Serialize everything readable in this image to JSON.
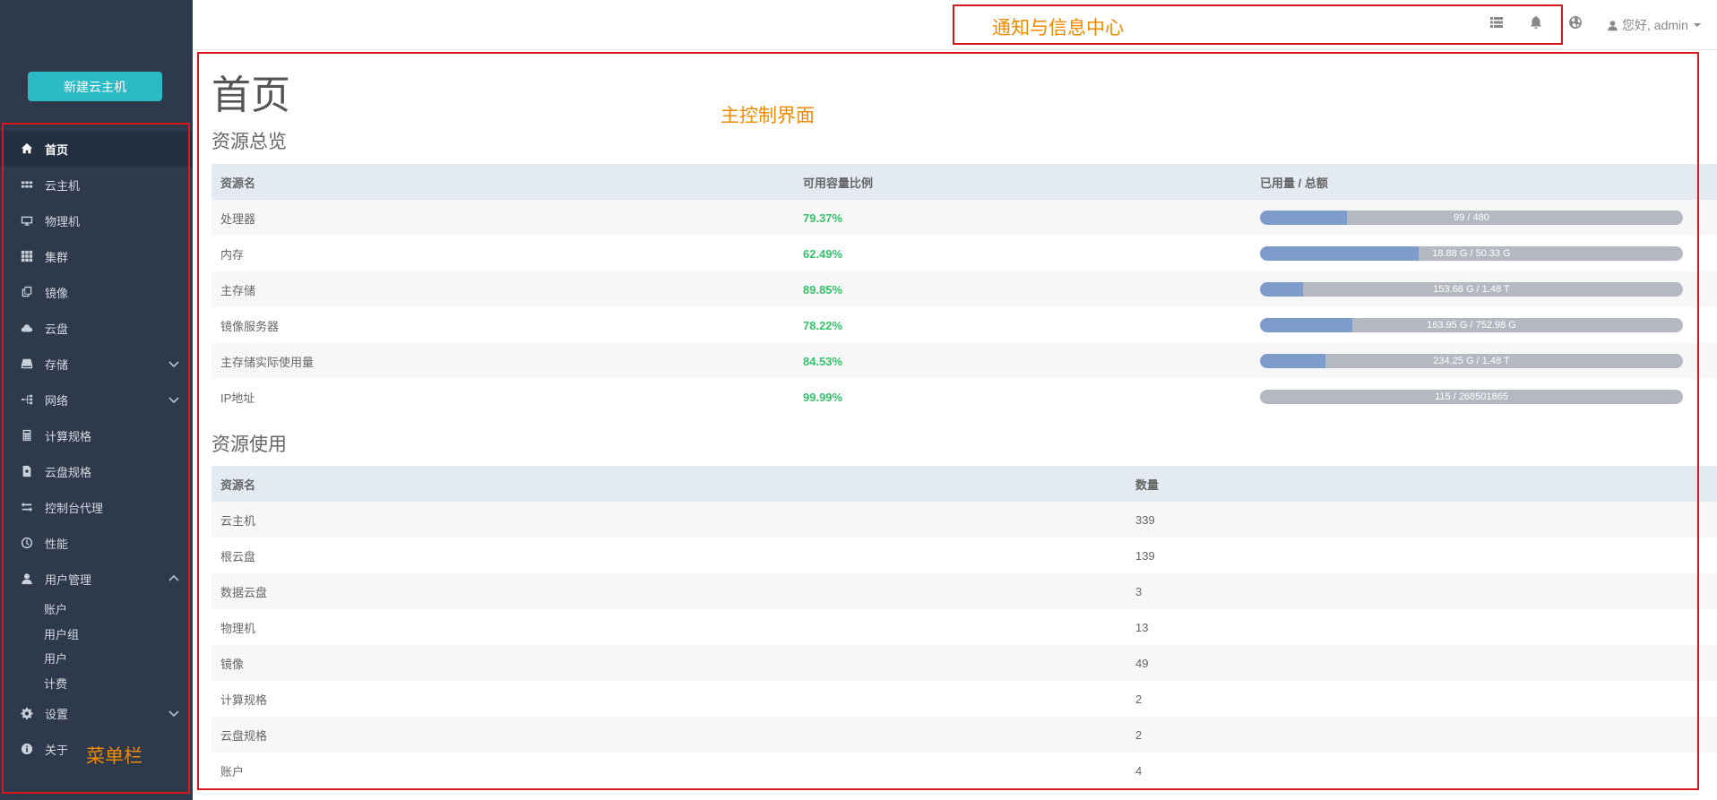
{
  "sidebar": {
    "new_button": "新建云主机",
    "items": [
      {
        "label": "首页",
        "icon": "home-icon",
        "active": true
      },
      {
        "label": "云主机",
        "icon": "grid-icon"
      },
      {
        "label": "物理机",
        "icon": "monitor-icon"
      },
      {
        "label": "集群",
        "icon": "apps-icon"
      },
      {
        "label": "镜像",
        "icon": "copy-icon"
      },
      {
        "label": "云盘",
        "icon": "cloud-icon"
      },
      {
        "label": "存储",
        "icon": "storage-icon",
        "chevron": "down"
      },
      {
        "label": "网络",
        "icon": "network-icon",
        "chevron": "down"
      },
      {
        "label": "计算规格",
        "icon": "calculator-icon"
      },
      {
        "label": "云盘规格",
        "icon": "disk-spec-icon"
      },
      {
        "label": "控制台代理",
        "icon": "transfer-icon"
      },
      {
        "label": "性能",
        "icon": "dashboard-icon"
      },
      {
        "label": "用户管理",
        "icon": "user-icon",
        "chevron": "up"
      },
      {
        "label": "设置",
        "icon": "gear-icon",
        "chevron": "down"
      },
      {
        "label": "关于",
        "icon": "info-icon"
      }
    ],
    "user_mgmt_sub": [
      "账户",
      "用户组",
      "用户",
      "计费"
    ]
  },
  "topbar": {
    "icons": [
      "list-icon",
      "bell-icon",
      "globe-icon"
    ],
    "user_greeting": "您好, admin"
  },
  "annotations": {
    "notification": "通知与信息中心",
    "main_panel": "主控制界面",
    "menu": "菜单栏"
  },
  "main": {
    "title": "首页",
    "overview": {
      "title": "资源总览",
      "headers": [
        "资源名",
        "可用容量比例",
        "已用量 / 总额"
      ],
      "rows": [
        {
          "name": "处理器",
          "pct": "79.37%",
          "usage": "99 / 480",
          "used_fraction": 0.2063
        },
        {
          "name": "内存",
          "pct": "62.49%",
          "usage": "18.88 G / 50.33 G",
          "used_fraction": 0.3751
        },
        {
          "name": "主存储",
          "pct": "89.85%",
          "usage": "153.68 G / 1.48 T",
          "used_fraction": 0.1015
        },
        {
          "name": "镜像服务器",
          "pct": "78.22%",
          "usage": "163.95 G / 752.98 G",
          "used_fraction": 0.2178
        },
        {
          "name": "主存储实际使用量",
          "pct": "84.53%",
          "usage": "234.25 G / 1.48 T",
          "used_fraction": 0.1547
        },
        {
          "name": "IP地址",
          "pct": "99.99%",
          "usage": "115 / 268501865",
          "used_fraction": 0.0001
        }
      ]
    },
    "usage": {
      "title": "资源使用",
      "headers": [
        "资源名",
        "数量"
      ],
      "rows": [
        {
          "name": "云主机",
          "count": "339"
        },
        {
          "name": "根云盘",
          "count": "139"
        },
        {
          "name": "数据云盘",
          "count": "3"
        },
        {
          "name": "物理机",
          "count": "13"
        },
        {
          "name": "镜像",
          "count": "49"
        },
        {
          "name": "计算规格",
          "count": "2"
        },
        {
          "name": "云盘规格",
          "count": "2"
        },
        {
          "name": "账户",
          "count": "4"
        }
      ]
    }
  }
}
